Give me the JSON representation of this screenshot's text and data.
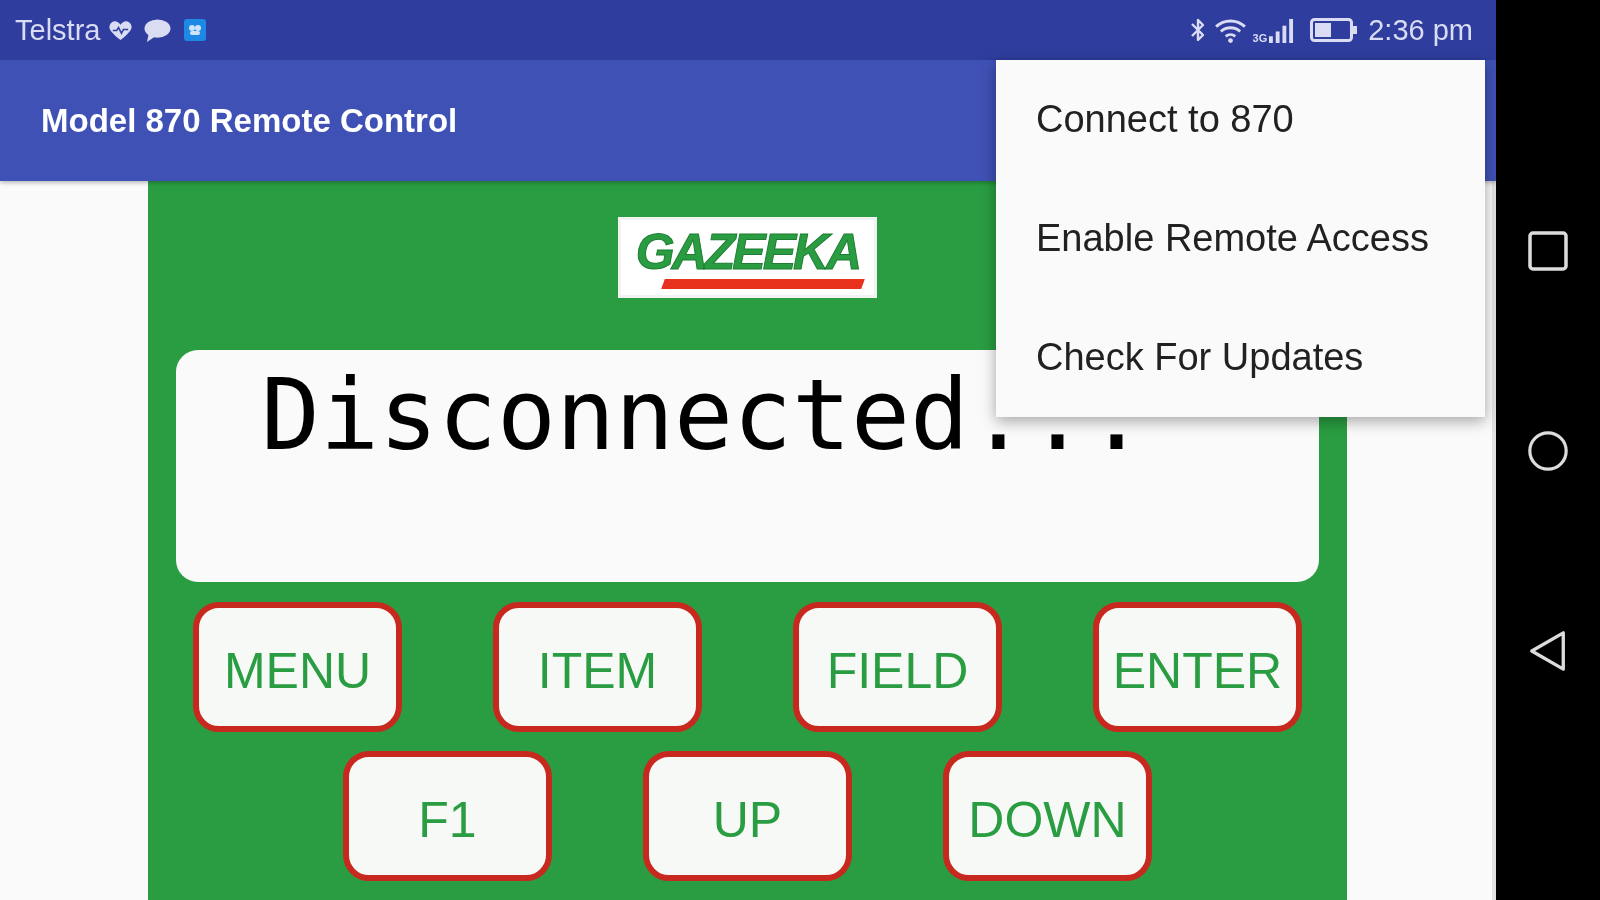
{
  "status_bar": {
    "carrier": "Telstra",
    "network_type": "3G",
    "time": "2:36 pm"
  },
  "app_bar": {
    "title": "Model 870 Remote Control"
  },
  "logo": {
    "text": "GAZEEKA"
  },
  "display": {
    "text": "Disconnected..."
  },
  "keypad": {
    "rows": [
      [
        {
          "label": "MENU"
        },
        {
          "label": "ITEM"
        },
        {
          "label": "FIELD"
        },
        {
          "label": "ENTER"
        }
      ],
      [
        {
          "label": "F1"
        },
        {
          "label": "UP"
        },
        {
          "label": "DOWN"
        }
      ]
    ]
  },
  "overflow_menu": {
    "items": [
      {
        "label": "Connect to 870"
      },
      {
        "label": "Enable Remote Access"
      },
      {
        "label": "Check For Updates"
      }
    ]
  }
}
